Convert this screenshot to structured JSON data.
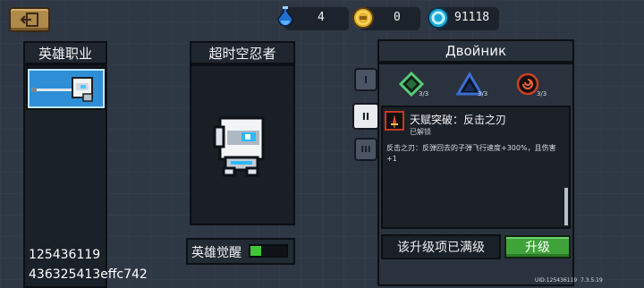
{
  "header": {
    "back_label": "back",
    "currencies": [
      {
        "name": "mana-potion",
        "value": "4"
      },
      {
        "name": "gold-coin",
        "value": "0"
      },
      {
        "name": "gem",
        "value": "91118"
      }
    ]
  },
  "hero_panel": {
    "title": "英雄职业"
  },
  "character_panel": {
    "title": "超时空忍者",
    "awaken_label": "英雄觉醒",
    "awaken_progress": 0.3
  },
  "skin_panel": {
    "title": "Двойник",
    "tabs": [
      "I",
      "II",
      "III"
    ],
    "active_tab": 1,
    "abilities": [
      {
        "icon": "green-diamond",
        "count": "3/3"
      },
      {
        "icon": "blue-triangle",
        "count": "3/3"
      },
      {
        "icon": "red-swirl",
        "count": "3/3"
      }
    ],
    "skill_name": "天赋突破：反击之刃",
    "skill_status": "已解锁",
    "skill_desc": "反击之刃：反弹回去的子弹飞行速度+300%，且伤害+1",
    "maxed_label": "该升级项已满级",
    "upgrade_label": "升级"
  },
  "overlay": {
    "id_line1": "125436119",
    "id_line2": "436325413effc742",
    "uid": "UID:125436119  7.3.5.19"
  },
  "colors": {
    "accent_green": "#3fa33a",
    "selected_blue": "#2f8fd6",
    "back_gold": "#b08a4a"
  }
}
